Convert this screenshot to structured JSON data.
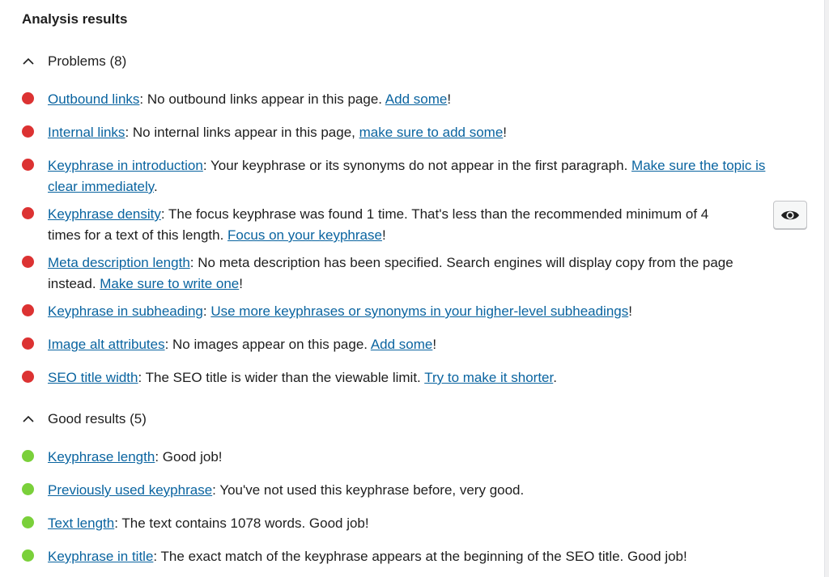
{
  "panel": {
    "title": "Analysis results"
  },
  "problems": {
    "heading": "Problems (8)",
    "items": [
      {
        "link": "Outbound links",
        "sep": ": ",
        "text": "No outbound links appear in this page. ",
        "action": "Add some",
        "tail": "!"
      },
      {
        "link": "Internal links",
        "sep": ": ",
        "text": "No internal links appear in this page, ",
        "action": "make sure to add some",
        "tail": "!"
      },
      {
        "link": "Keyphrase in introduction",
        "sep": ": ",
        "text": "Your keyphrase or its synonyms do not appear in the first paragraph. ",
        "action": "Make sure the topic is clear immediately",
        "tail": "."
      },
      {
        "link": "Keyphrase density",
        "sep": ": ",
        "text": "The focus keyphrase was found 1 time. That's less than the recommended minimum of 4 times for a text of this length. ",
        "action": "Focus on your keyphrase",
        "tail": "!"
      },
      {
        "link": "Meta description length",
        "sep": ": ",
        "text": "No meta description has been specified. Search engines will display copy from the page instead. ",
        "action": "Make sure to write one",
        "tail": "!"
      },
      {
        "link": "Keyphrase in subheading",
        "sep": ": ",
        "text": "",
        "action": "Use more keyphrases or synonyms in your higher-level subheadings",
        "tail": "!"
      },
      {
        "link": "Image alt attributes",
        "sep": ": ",
        "text": "No images appear on this page. ",
        "action": "Add some",
        "tail": "!"
      },
      {
        "link": "SEO title width",
        "sep": ": ",
        "text": "The SEO title is wider than the viewable limit. ",
        "action": "Try to make it shorter",
        "tail": "."
      }
    ]
  },
  "good": {
    "heading": "Good results (5)",
    "items": [
      {
        "link": "Keyphrase length",
        "sep": ": ",
        "text": "Good job!"
      },
      {
        "link": "Previously used keyphrase",
        "sep": ": ",
        "text": "You've not used this keyphrase before, very good."
      },
      {
        "link": "Text length",
        "sep": ": ",
        "text": "The text contains 1078 words. Good job!"
      },
      {
        "link": "Keyphrase in title",
        "sep": ": ",
        "text": "The exact match of the keyphrase appears at the beginning of the SEO title. Good job!"
      }
    ]
  },
  "colors": {
    "problem": "#dc3232",
    "good": "#7ad03a",
    "link": "#0a64a0"
  },
  "icons": {
    "collapse": "chevron-up-icon",
    "highlight": "eye-icon"
  }
}
